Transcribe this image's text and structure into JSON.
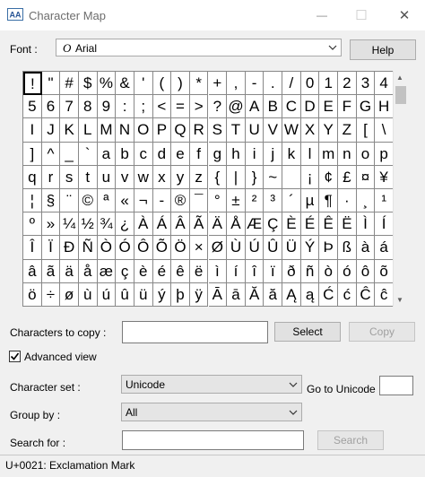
{
  "window": {
    "title": "Character Map",
    "minimize_glyph": "—",
    "maximize_glyph": "☐",
    "close_glyph": "✕"
  },
  "font_row": {
    "label": "Font :",
    "value": "Arial",
    "font_icon": "O",
    "help_label": "Help"
  },
  "characters": [
    [
      "!",
      "\"",
      "#",
      "$",
      "%",
      "&",
      "'",
      "(",
      ")",
      "*",
      "+",
      ",",
      "-",
      ".",
      "/",
      "0",
      "1",
      "2",
      "3",
      "4"
    ],
    [
      "5",
      "6",
      "7",
      "8",
      "9",
      ":",
      ";",
      "<",
      "=",
      ">",
      "?",
      "@",
      "A",
      "B",
      "C",
      "D",
      "E",
      "F",
      "G",
      "H"
    ],
    [
      "I",
      "J",
      "K",
      "L",
      "M",
      "N",
      "O",
      "P",
      "Q",
      "R",
      "S",
      "T",
      "U",
      "V",
      "W",
      "X",
      "Y",
      "Z",
      "[",
      "\\"
    ],
    [
      "]",
      "^",
      "_",
      "`",
      "a",
      "b",
      "c",
      "d",
      "e",
      "f",
      "g",
      "h",
      "i",
      "j",
      "k",
      "l",
      "m",
      "n",
      "o",
      "p"
    ],
    [
      "q",
      "r",
      "s",
      "t",
      "u",
      "v",
      "w",
      "x",
      "y",
      "z",
      "{",
      "|",
      "}",
      "~",
      "",
      "¡",
      "¢",
      "£",
      "¤",
      "¥"
    ],
    [
      "¦",
      "§",
      "¨",
      "©",
      "ª",
      "«",
      "¬",
      "-",
      "®",
      "¯",
      "°",
      "±",
      "²",
      "³",
      "´",
      "µ",
      "¶",
      "·",
      "¸",
      "¹"
    ],
    [
      "º",
      "»",
      "¼",
      "½",
      "¾",
      "¿",
      "À",
      "Á",
      "Â",
      "Ã",
      "Ä",
      "Å",
      "Æ",
      "Ç",
      "È",
      "É",
      "Ê",
      "Ë",
      "Ì",
      "Í"
    ],
    [
      "Î",
      "Ï",
      "Ð",
      "Ñ",
      "Ò",
      "Ó",
      "Ô",
      "Õ",
      "Ö",
      "×",
      "Ø",
      "Ù",
      "Ú",
      "Û",
      "Ü",
      "Ý",
      "Þ",
      "ß",
      "à",
      "á"
    ],
    [
      "â",
      "ã",
      "ä",
      "å",
      "æ",
      "ç",
      "è",
      "é",
      "ê",
      "ë",
      "ì",
      "í",
      "î",
      "ï",
      "ð",
      "ñ",
      "ò",
      "ó",
      "ô",
      "õ"
    ],
    [
      "ö",
      "÷",
      "ø",
      "ù",
      "ú",
      "û",
      "ü",
      "ý",
      "þ",
      "ÿ",
      "Ā",
      "ā",
      "Ă",
      "ă",
      "Ą",
      "ą",
      "Ć",
      "ć",
      "Ĉ",
      "ĉ"
    ]
  ],
  "selected_character": "!",
  "copy_row": {
    "label": "Characters to copy :",
    "value": "",
    "select_label": "Select",
    "copy_label": "Copy"
  },
  "advanced_view": {
    "label": "Advanced view",
    "checked": true,
    "check_glyph": "✓"
  },
  "character_set": {
    "label": "Character set :",
    "value": "Unicode",
    "goto_label": "Go to Unicode :",
    "goto_value": ""
  },
  "group_by": {
    "label": "Group by :",
    "value": "All"
  },
  "search": {
    "label": "Search for :",
    "value": "",
    "button_label": "Search"
  },
  "status": {
    "text": "U+0021: Exclamation Mark"
  }
}
